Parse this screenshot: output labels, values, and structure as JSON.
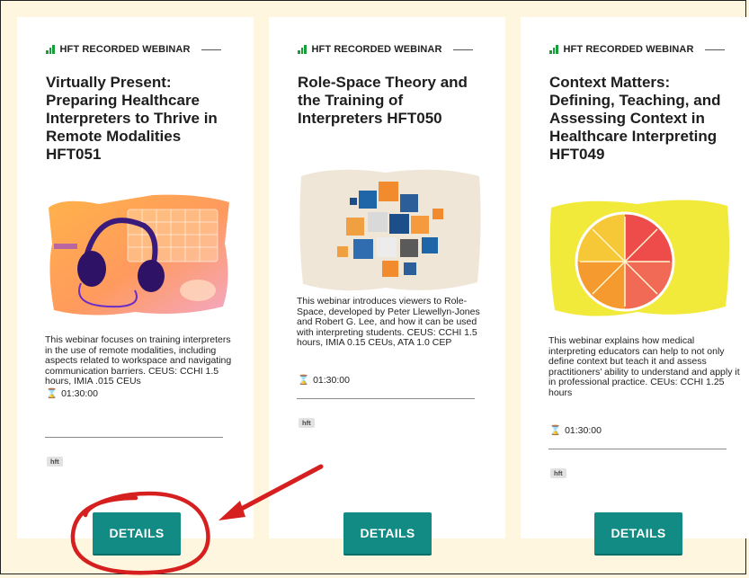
{
  "cards": [
    {
      "eyebrow": "HFT RECORDED WEBINAR",
      "title": "Virtually Present: Preparing Healthcare Interpreters to Thrive in Remote Modalities HFT051",
      "description": "This webinar focuses on training interpreters in the use of remote modalities, including aspects related to workspace and navigating communication barriers. CEUS: CCHI 1.5 hours, IMIA .015 CEUs",
      "duration": "01:30:00",
      "tag": "hft",
      "button": "DETAILS",
      "image_icon": "headphones-keyboard-image"
    },
    {
      "eyebrow": "HFT RECORDED WEBINAR",
      "title": "Role-Space Theory and the Training of Interpreters HFT050",
      "description": "This webinar introduces viewers to Role-Space, developed by Peter Llewellyn-Jones and Robert G. Lee, and how it can be used with interpreting students. CEUS: CCHI 1.5 hours, IMIA 0.15 CEUs, ATA 1.0 CEP",
      "duration": "01:30:00",
      "tag": "hft",
      "button": "DETAILS",
      "image_icon": "cubes-image"
    },
    {
      "eyebrow": "HFT RECORDED WEBINAR",
      "title": "Context Matters: Defining, Teaching, and Assessing Context in Healthcare Interpreting HFT049",
      "description": "This webinar explains how medical interpreting educators can help to not only define context but teach it and assess practitioners’ ability to understand and apply it in professional practice. CEUs: CCHI 1.25 hours",
      "duration": "01:30:00",
      "tag": "hft",
      "button": "DETAILS",
      "image_icon": "citrus-slices-image"
    }
  ],
  "annotation": {
    "circle_color": "#d61f1f",
    "arrow_color": "#d61f1f"
  },
  "colors": {
    "accent": "#128b84",
    "eyebrow_bars": "#1a9d3b",
    "page_bg": "#fff6e0"
  }
}
